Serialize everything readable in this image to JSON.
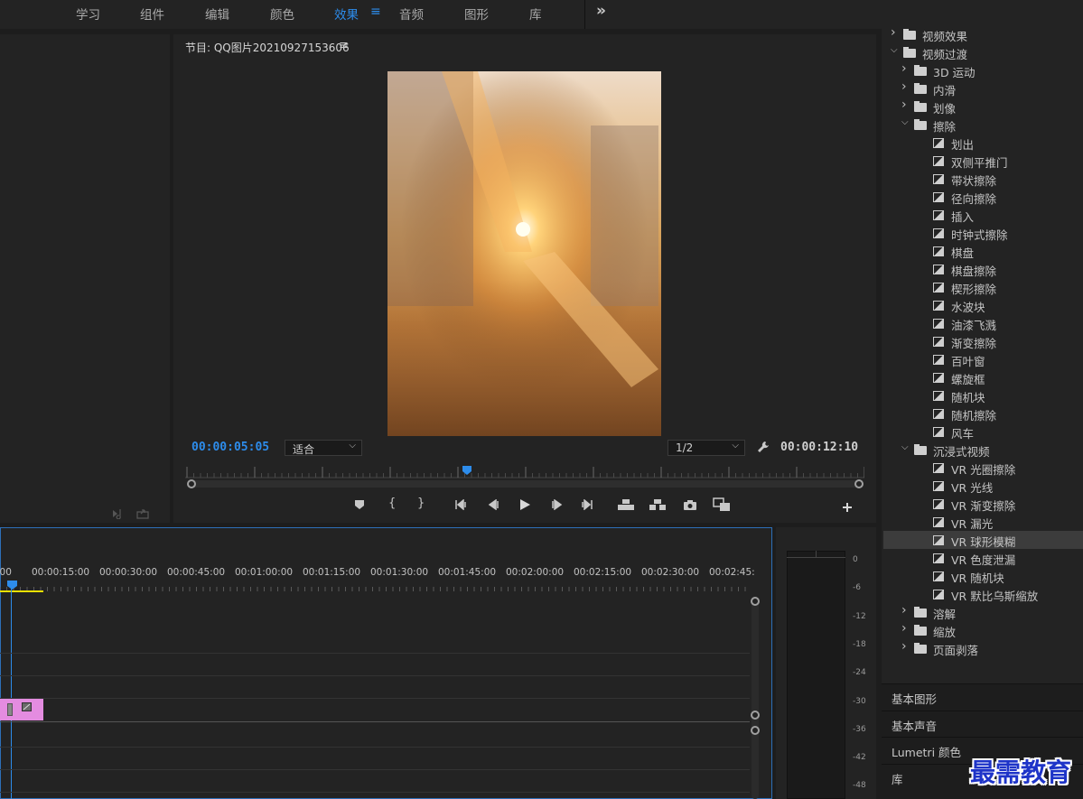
{
  "menu": {
    "items": [
      "学习",
      "组件",
      "编辑",
      "颜色",
      "效果",
      "音频",
      "图形",
      "库"
    ],
    "active": "效果",
    "burger_icon": "≡",
    "more_icon": "»"
  },
  "program_monitor": {
    "title": "节目: QQ图片20210927153606",
    "menu_icon": "≡",
    "current_time": "00:00:05:05",
    "fit_select": "适合",
    "resolution_select": "1/2",
    "duration": "00:00:12:10"
  },
  "timeline": {
    "timecodes": [
      ":00",
      "00:00:15:00",
      "00:00:30:00",
      "00:00:45:00",
      "00:01:00:00",
      "00:01:15:00",
      "00:01:30:00",
      "00:01:45:00",
      "00:02:00:00",
      "00:02:15:00",
      "00:02:30:00",
      "00:02:45:"
    ]
  },
  "audio_meter": {
    "labels": [
      "0",
      "-6",
      "-12",
      "-18",
      "-24",
      "-30",
      "-36",
      "-42",
      "-48"
    ]
  },
  "effects_tree": [
    {
      "kind": "folder",
      "level": 0,
      "open": false,
      "label": "视频效果"
    },
    {
      "kind": "folder",
      "level": 0,
      "open": true,
      "label": "视频过渡"
    },
    {
      "kind": "folder",
      "level": 1,
      "open": false,
      "label": "3D 运动"
    },
    {
      "kind": "folder",
      "level": 1,
      "open": false,
      "label": "内滑"
    },
    {
      "kind": "folder",
      "level": 1,
      "open": false,
      "label": "划像"
    },
    {
      "kind": "folder",
      "level": 1,
      "open": true,
      "label": "擦除"
    },
    {
      "kind": "fx",
      "level": 2,
      "label": "划出"
    },
    {
      "kind": "fx",
      "level": 2,
      "label": "双侧平推门"
    },
    {
      "kind": "fx",
      "level": 2,
      "label": "带状擦除"
    },
    {
      "kind": "fx",
      "level": 2,
      "label": "径向擦除"
    },
    {
      "kind": "fx",
      "level": 2,
      "label": "插入"
    },
    {
      "kind": "fx",
      "level": 2,
      "label": "时钟式擦除"
    },
    {
      "kind": "fx",
      "level": 2,
      "label": "棋盘"
    },
    {
      "kind": "fx",
      "level": 2,
      "label": "棋盘擦除"
    },
    {
      "kind": "fx",
      "level": 2,
      "label": "楔形擦除"
    },
    {
      "kind": "fx",
      "level": 2,
      "label": "水波块"
    },
    {
      "kind": "fx",
      "level": 2,
      "label": "油漆飞溅"
    },
    {
      "kind": "fx",
      "level": 2,
      "label": "渐变擦除"
    },
    {
      "kind": "fx",
      "level": 2,
      "label": "百叶窗"
    },
    {
      "kind": "fx",
      "level": 2,
      "label": "螺旋框"
    },
    {
      "kind": "fx",
      "level": 2,
      "label": "随机块"
    },
    {
      "kind": "fx",
      "level": 2,
      "label": "随机擦除"
    },
    {
      "kind": "fx",
      "level": 2,
      "label": "风车"
    },
    {
      "kind": "folder",
      "level": 1,
      "open": true,
      "label": "沉浸式视频"
    },
    {
      "kind": "fx",
      "level": 2,
      "label": "VR 光圈擦除"
    },
    {
      "kind": "fx",
      "level": 2,
      "label": "VR 光线"
    },
    {
      "kind": "fx",
      "level": 2,
      "label": "VR 渐变擦除"
    },
    {
      "kind": "fx",
      "level": 2,
      "label": "VR 漏光"
    },
    {
      "kind": "fx",
      "level": 2,
      "label": "VR 球形模糊",
      "selected": true
    },
    {
      "kind": "fx",
      "level": 2,
      "label": "VR 色度泄漏"
    },
    {
      "kind": "fx",
      "level": 2,
      "label": "VR 随机块"
    },
    {
      "kind": "fx",
      "level": 2,
      "label": "VR 默比乌斯缩放"
    },
    {
      "kind": "folder",
      "level": 1,
      "open": false,
      "label": "溶解"
    },
    {
      "kind": "folder",
      "level": 1,
      "open": false,
      "label": "缩放"
    },
    {
      "kind": "folder",
      "level": 1,
      "open": false,
      "label": "页面剥落"
    }
  ],
  "side_sections": [
    "基本图形",
    "基本声音",
    "Lumetri 颜色",
    "库"
  ],
  "watermark": "最需教育",
  "colors": {
    "accent": "#2d8ceb",
    "clip": "#e48ce0",
    "work_area": "#e8e000"
  }
}
